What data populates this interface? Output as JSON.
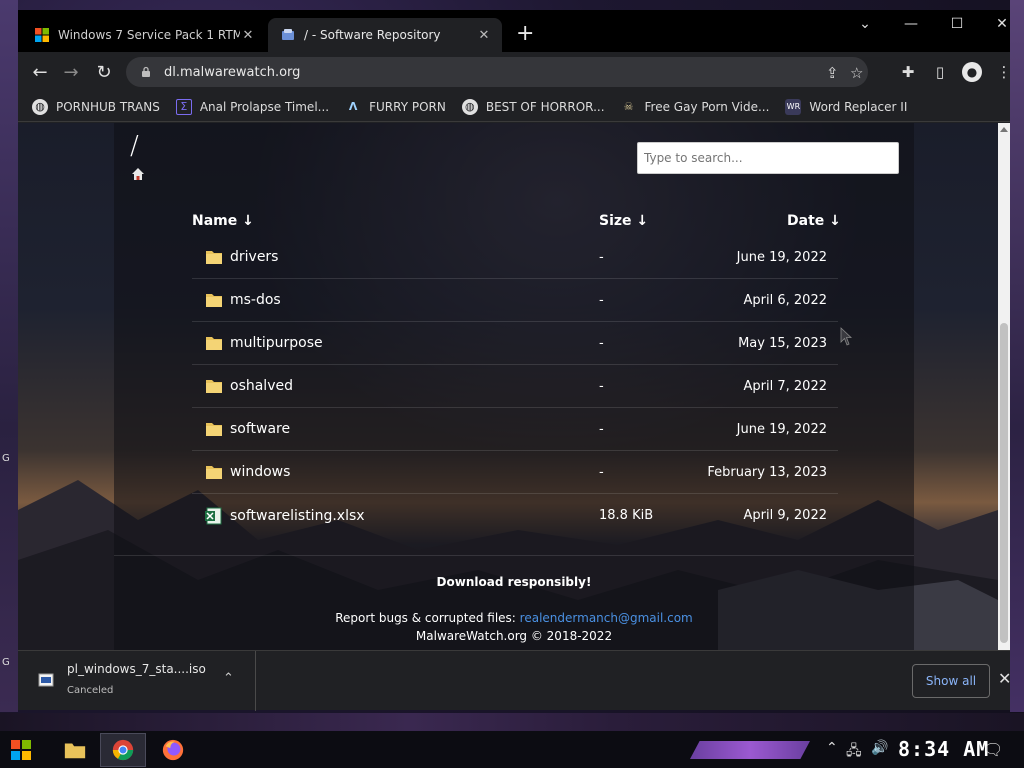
{
  "desktop": {
    "left_letters": [
      "G",
      "G"
    ]
  },
  "tabs": [
    {
      "title": "Windows 7 Service Pack 1 RTM",
      "close": "✕"
    },
    {
      "title": "/ - Software Repository",
      "close": "✕"
    }
  ],
  "new_tab": "+",
  "window_controls": {
    "menu": "⌄",
    "minimize": "—",
    "maximize": "☐",
    "close": "✕"
  },
  "toolbar": {
    "back": "←",
    "forward": "→",
    "reload": "↻",
    "url": "dl.malwarewatch.org",
    "share": "⇪",
    "star": "☆",
    "extensions": "✚",
    "sidepanel": "▯",
    "profile": "●",
    "menu": "⋮"
  },
  "bookmarks": [
    {
      "label": "PORNHUB TRANS",
      "icon": "globe-icon"
    },
    {
      "label": "Anal Prolapse Timel...",
      "icon": "sigma-icon"
    },
    {
      "label": "FURRY PORN",
      "icon": "lambda-icon"
    },
    {
      "label": "BEST OF HORROR...",
      "icon": "globe-icon"
    },
    {
      "label": "Free Gay Porn Vide...",
      "icon": "skull-icon"
    },
    {
      "label": "Word Replacer II",
      "icon": "wr-icon"
    }
  ],
  "page": {
    "path": "/",
    "search_placeholder": "Type to search...",
    "columns": {
      "name": "Name ↓",
      "size": "Size ↓",
      "date": "Date ↓"
    },
    "rows": [
      {
        "name": "drivers",
        "size": "-",
        "date": "June 19, 2022",
        "type": "folder"
      },
      {
        "name": "ms-dos",
        "size": "-",
        "date": "April 6, 2022",
        "type": "folder"
      },
      {
        "name": "multipurpose",
        "size": "-",
        "date": "May 15, 2023",
        "type": "folder"
      },
      {
        "name": "oshalved",
        "size": "-",
        "date": "April 7, 2022",
        "type": "folder"
      },
      {
        "name": "software",
        "size": "-",
        "date": "June 19, 2022",
        "type": "folder"
      },
      {
        "name": "windows",
        "size": "-",
        "date": "February 13, 2023",
        "type": "folder"
      },
      {
        "name": "softwarelisting.xlsx",
        "size": "18.8 KiB",
        "date": "April 9, 2022",
        "type": "xlsx"
      }
    ],
    "footer": {
      "tagline": "Download responsibly!",
      "report_prefix": "Report bugs & corrupted files:",
      "email": "realendermanch@gmail.com",
      "copyright": "MalwareWatch.org © 2018-2022"
    }
  },
  "download_shelf": {
    "file": "pl_windows_7_sta....iso",
    "status": "Canceled",
    "chevron": "⌃",
    "show_all": "Show all",
    "close": "✕"
  },
  "taskbar": {
    "tray_chevron": "⌃",
    "tray_network": "🖧",
    "tray_volume": "🔊",
    "clock": "8:34 AM",
    "notifications": "🗨"
  },
  "colors": {
    "link": "#4a90e2",
    "show_all": "#8ab4f8",
    "taskbar_accent": "#9b59d0"
  }
}
